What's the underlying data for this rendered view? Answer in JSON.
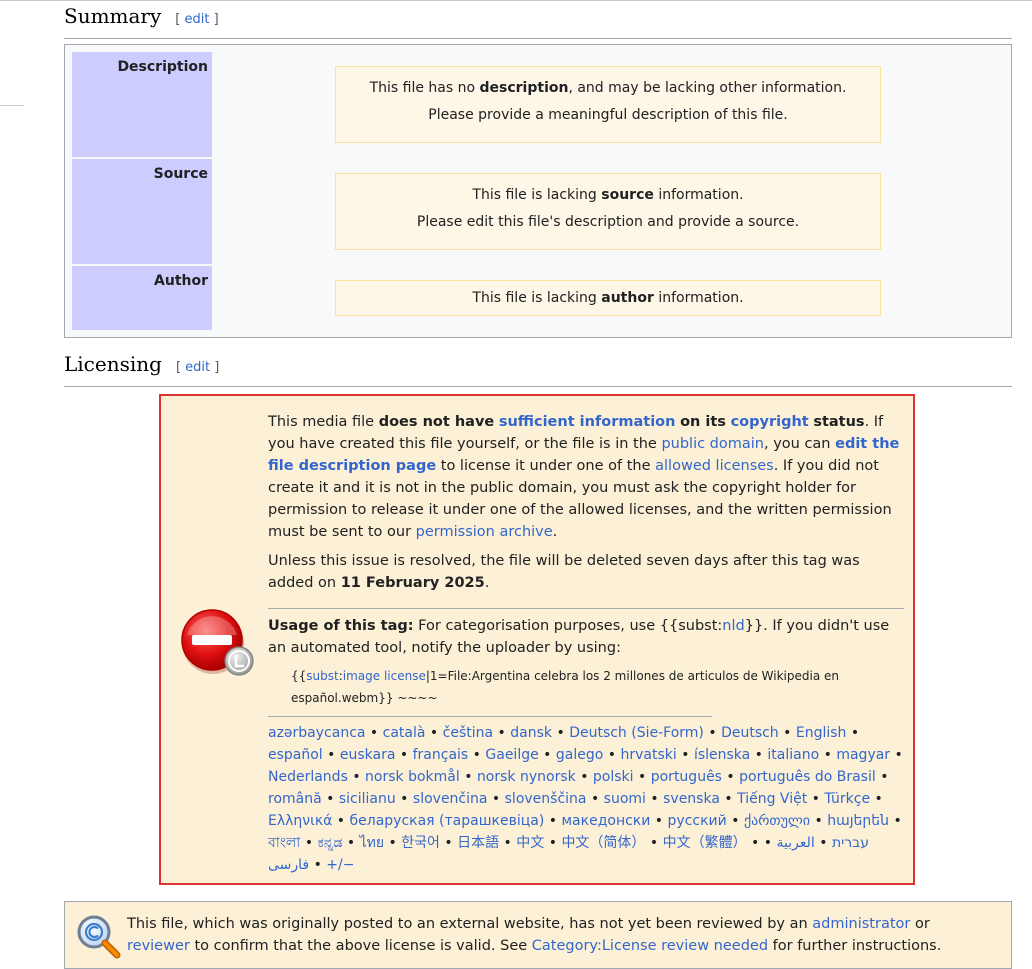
{
  "summary": {
    "heading": "Summary",
    "edit_open": "[",
    "edit_label": "edit",
    "edit_close": "]",
    "rows": [
      {
        "label": "Description",
        "line1_pre": "This file has no ",
        "line1_bold": "description",
        "line1_post": ", and may be lacking other information.",
        "line2": "Please provide a meaningful description of this file."
      },
      {
        "label": "Source",
        "line1_pre": "This file is lacking ",
        "line1_bold": "source",
        "line1_post": " information.",
        "line2": "Please edit this file's description and provide a source."
      },
      {
        "label": "Author",
        "line1_pre": "This file is lacking ",
        "line1_bold": "author",
        "line1_post": " information."
      }
    ]
  },
  "licensing": {
    "heading": "Licensing",
    "edit_open": "[",
    "edit_label": "edit",
    "edit_close": "]",
    "p1": {
      "t1": "This media file ",
      "b1": "does not have",
      "l1": "sufficient information",
      "b2": "on its",
      "l2": "copyright",
      "b3": "status",
      "t2": ". If you have created this file yourself, or the file is in the ",
      "l3": "public domain",
      "t3": ", you can ",
      "l4": "edit the file description page",
      "t4": " to license it under one of the ",
      "l5": "allowed licenses",
      "t5": ". If you did not create it and it is not in the public domain, you must ask the copyright holder for permission to release it under one of the allowed licenses, and the written permission must be sent to our ",
      "l6": "permission archive",
      "t6": "."
    },
    "p2": {
      "t1": "Unless this issue is resolved, the file will be deleted seven days after this tag was added on ",
      "b1": "11 February 2025",
      "t2": "."
    },
    "usage": {
      "label": "Usage of this tag:",
      "t1": " For categorisation purposes, use {{subst:",
      "l1": "nld",
      "t2": "}}. If you didn't use an automated tool, notify the uploader by using:"
    },
    "code": {
      "t1": "{{",
      "l1": "subst",
      "t2": ":",
      "l2": "image license",
      "t3": "|1=File:Argentina celebra los 2 millones de articulos de Wikipedia en español.webm}} ~~~~"
    },
    "languages": [
      "azərbaycanca",
      "català",
      "čeština",
      "dansk",
      "Deutsch (Sie-Form)",
      "Deutsch",
      "English",
      "español",
      "euskara",
      "français",
      "Gaeilge",
      "galego",
      "hrvatski",
      "íslenska",
      "italiano",
      "magyar",
      "Nederlands",
      "norsk bokmål",
      "norsk nynorsk",
      "polski",
      "português",
      "português do Brasil",
      "română",
      "sicilianu",
      "slovenčina",
      "slovenščina",
      "suomi",
      "svenska",
      "Tiếng Việt",
      "Türkçe",
      "Ελληνικά",
      "беларуская (тарашкевіца)",
      "македонски",
      "русский",
      "ქართული",
      "հայերեն",
      "বাংলা",
      "ಕನ್ನಡ",
      "ไทย",
      "한국어",
      "日本語",
      "中文",
      "中文（简体）",
      "中文（繁體）",
      "עברית",
      "العربية",
      "فارسی",
      "+/−"
    ],
    "separator": " • "
  },
  "review": {
    "t1": "This file, which was originally posted to an external website, has not yet been reviewed by an ",
    "l1": "administrator",
    "t2": " or ",
    "l2": "reviewer",
    "t3": " to confirm that the above license is valid. See ",
    "l3": "Category:License review needed",
    "t4": " for further instructions."
  },
  "icons": {
    "license_icon": "no-entry-copyright-icon",
    "review_icon": "magnifier-copyright-icon"
  },
  "colors": {
    "label_bg": "#ccccff",
    "warn_bg": "#fef6e7",
    "license_border": "#dd3333",
    "license_bg": "#fcf1d6",
    "link": "#3366cc"
  }
}
